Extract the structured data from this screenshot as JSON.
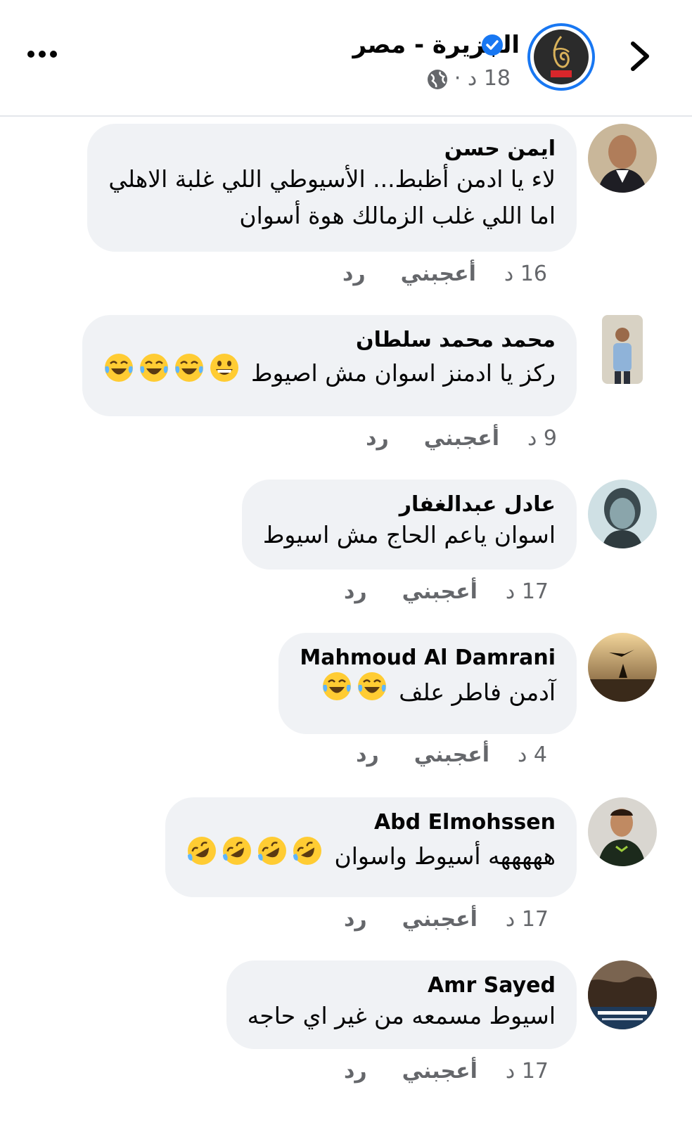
{
  "header": {
    "page_name": "الجزيرة  - مصر",
    "meta": "18 د ·",
    "avatar_badge": "مصر"
  },
  "actions": {
    "like": "أعجبني",
    "reply": "رد"
  },
  "comments": [
    {
      "author": "ايمن حسن",
      "lines": [
        "لاء يا ادمن أظبط... الأسيوطي اللي غلبة الاهلي",
        "اما اللي غلب الزمالك هوة أسوان"
      ],
      "time": "16 د"
    },
    {
      "author": "محمد محمد سلطان",
      "lines": [
        "ركز يا ادمنز اسوان مش اصيوط"
      ],
      "emoji": [
        "grinning",
        "tears-of-joy",
        "tears-of-joy",
        "tears-of-joy"
      ],
      "time": "9 د"
    },
    {
      "author": "عادل عبدالغفار",
      "lines": [
        "اسوان ياعم الحاج مش اسيوط"
      ],
      "time": "17 د"
    },
    {
      "author": "Mahmoud Al Damrani",
      "lines": [
        "آدمن فاطر علف"
      ],
      "emoji": [
        "tears-of-joy",
        "tears-of-joy"
      ],
      "time": "4 د"
    },
    {
      "author": "Abd Elmohssen",
      "lines": [
        "هههههه أسيوط واسوان"
      ],
      "emoji": [
        "rofl",
        "rofl",
        "rofl",
        "rofl"
      ],
      "time": "17 د"
    },
    {
      "author": "Amr Sayed",
      "lines": [
        "اسيوط مسمعه من غير اي حاجه"
      ],
      "time": "17 د"
    }
  ],
  "colors": {
    "accent": "#1877f2",
    "bubble": "#f0f2f5",
    "secondary_text": "#65676b"
  }
}
